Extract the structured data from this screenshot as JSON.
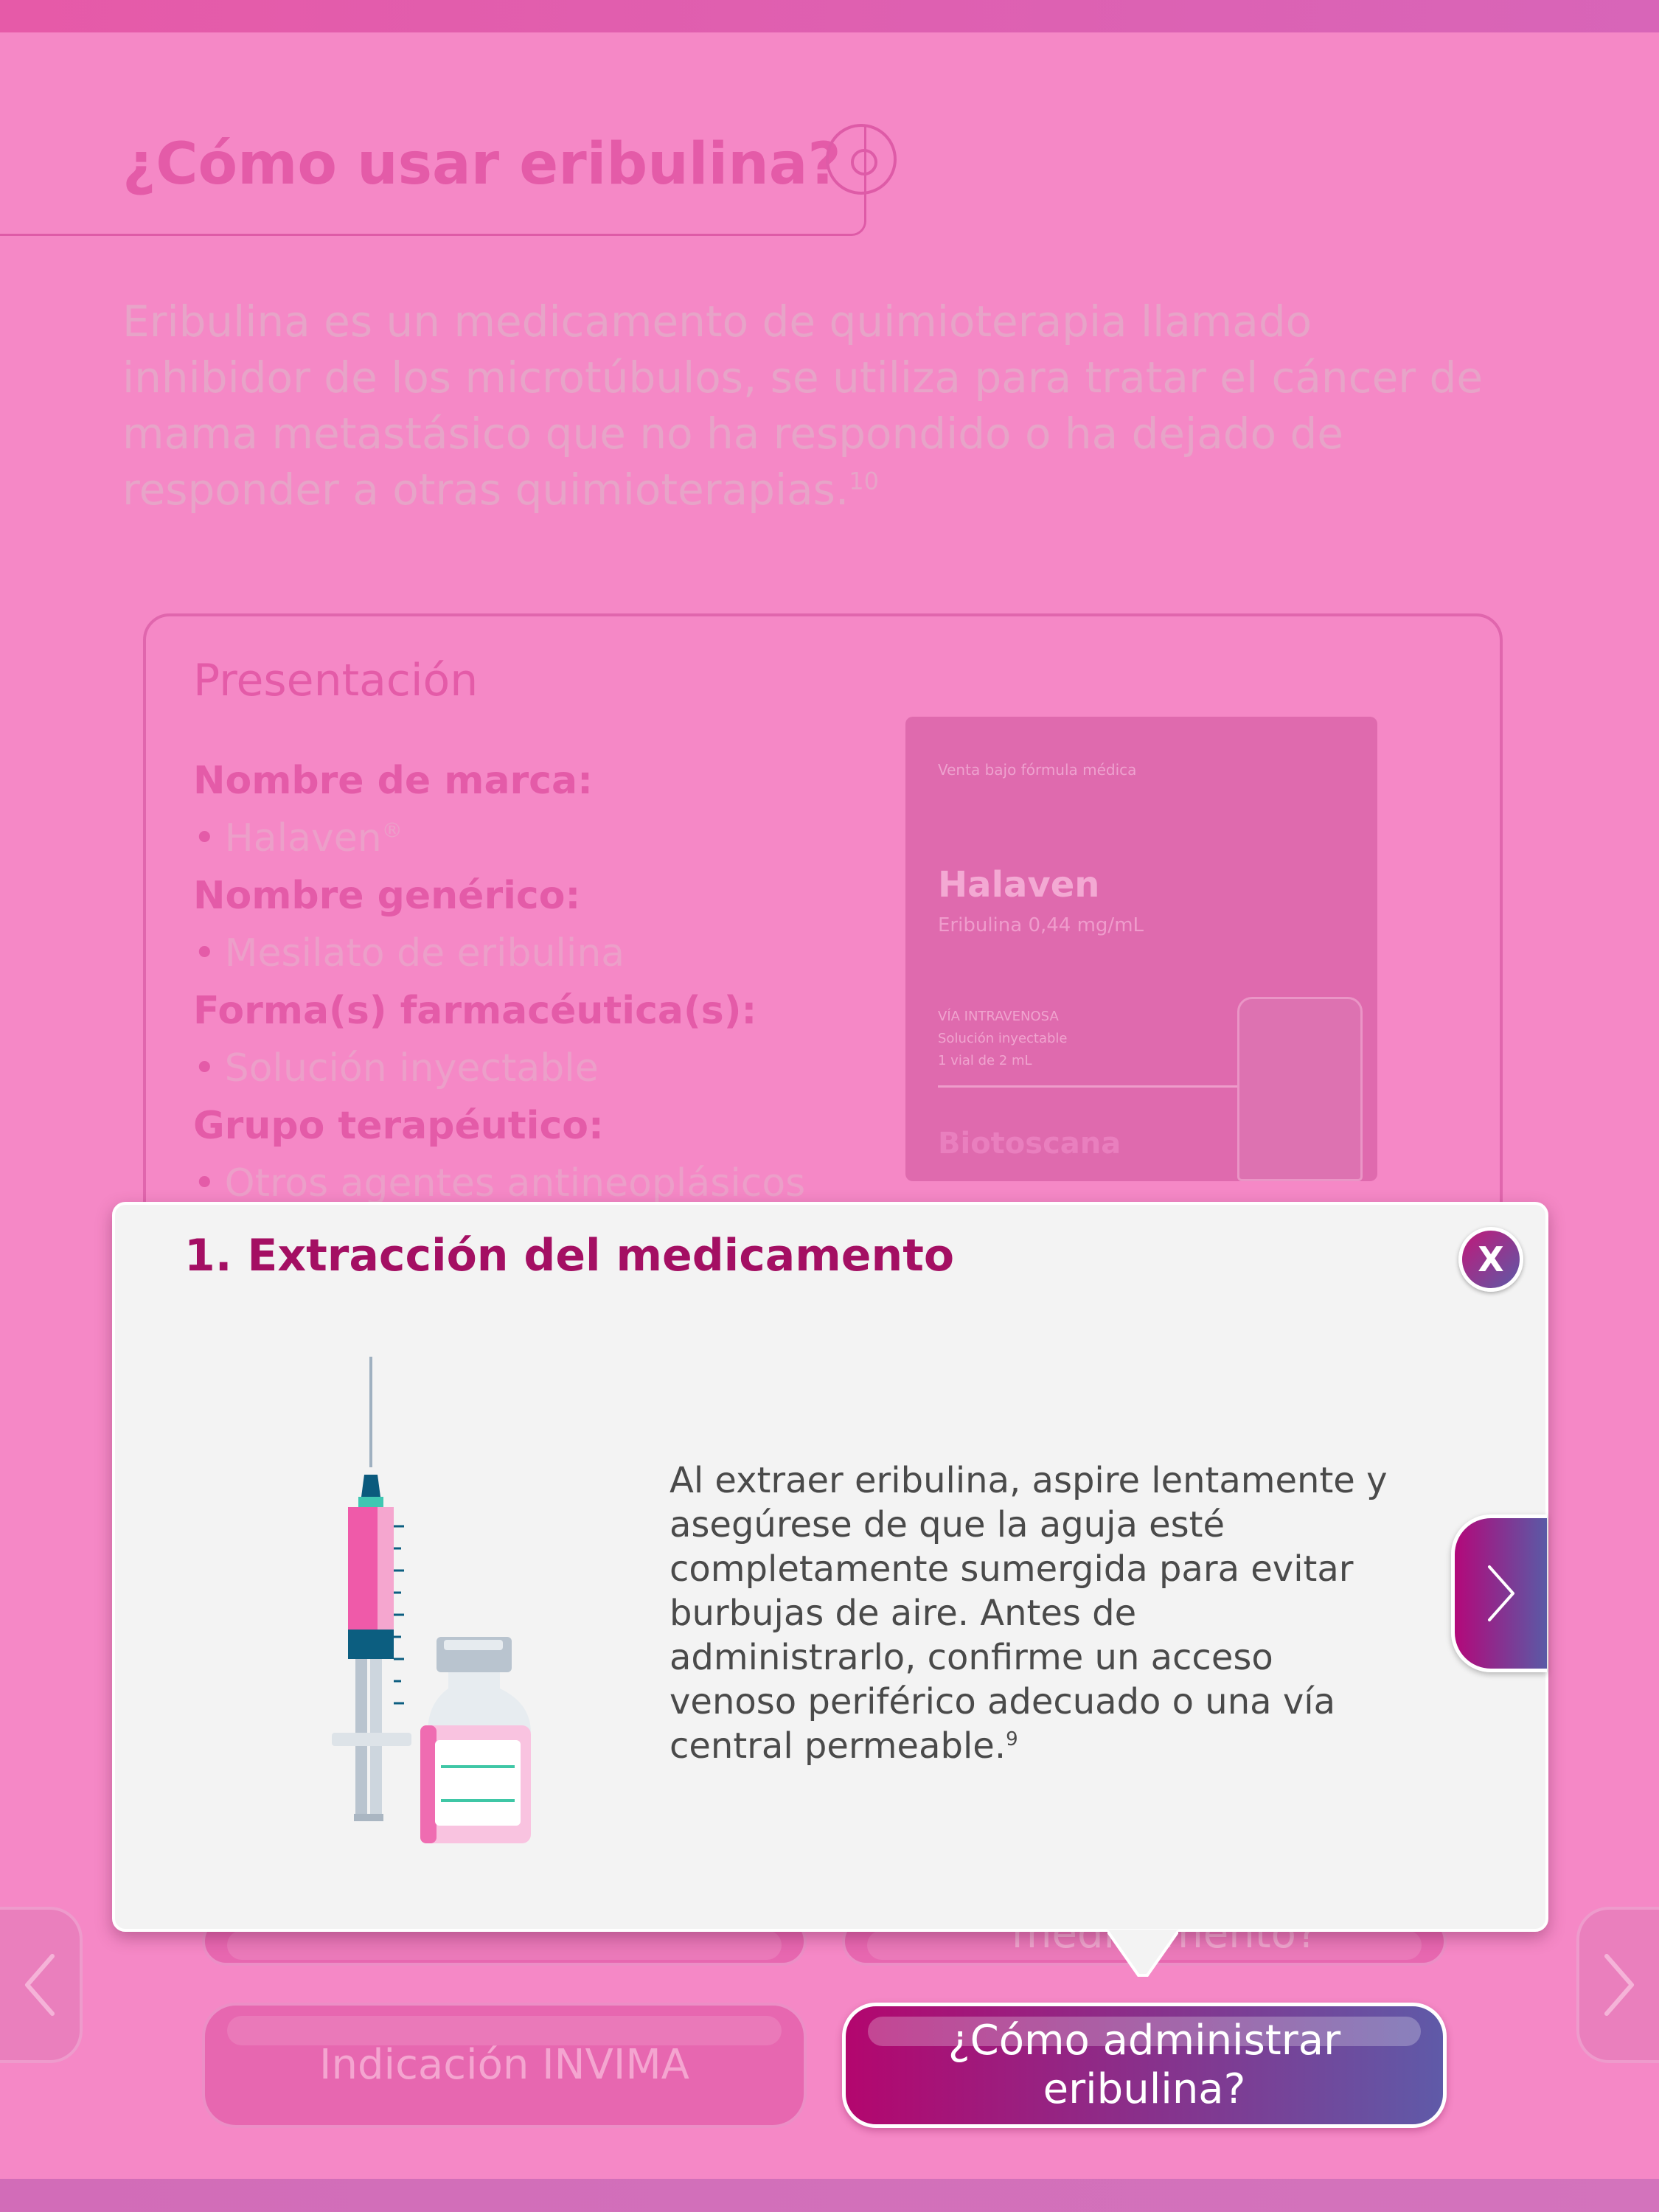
{
  "page": {
    "title": "¿Cómo usar eribulina?",
    "intro": "Eribulina es un medicamento de quimioterapia llamado inhibidor de los microtúbulos, se utiliza para tratar el cáncer de mama metastásico que no ha respondido o ha dejado de responder a otras quimioterapias.",
    "intro_ref": "10"
  },
  "presentation": {
    "title": "Presentación",
    "brand_label": "Nombre de marca:",
    "brand_value": "Halaven",
    "brand_mark": "®",
    "generic_label": "Nombre genérico:",
    "generic_value": "Mesilato de eribulina",
    "form_label": "Forma(s) farmacéutica(s):",
    "form_value": "Solución inyectable",
    "group_label": "Grupo terapéutico:",
    "group_value": "Otros agentes antineoplásicos"
  },
  "product_box": {
    "small_text": "Venta bajo fórmula médica",
    "brand": "Halaven",
    "concentration": "Eribulina 0,44 mg/mL",
    "route": "VÍA INTRAVENOSA",
    "form": "Solución inyectable",
    "content": "1 vial de 2 mL",
    "maker": "Biotoscana"
  },
  "modal": {
    "title": "1. Extracción del medicamento",
    "close_label": "X",
    "text": "Al extraer eribulina, aspire lentamente y asegúrese de que la aguja esté completamente sumergida para evitar burbujas de aire. Antes de administrarlo, confirme un acceso venoso periférico adecuado o una vía central permeable.",
    "text_ref": "9"
  },
  "nav_buttons": {
    "partial_text": "medicamento?",
    "invima": "Indicación INVIMA",
    "administer": "¿Cómo administrar eribulina?"
  },
  "colors": {
    "background": "#f588c6",
    "accent": "#a40f63",
    "gradient_start": "#b3066e",
    "gradient_end": "#5f5aa8"
  },
  "icons": {
    "title_icon": "target-circle-icon",
    "close_icon": "close-icon",
    "next_icon": "chevron-right-icon",
    "left_nav_icon": "chevron-left-icon",
    "right_nav_icon": "chevron-right-icon",
    "illustration": "syringe-vial-icon"
  }
}
